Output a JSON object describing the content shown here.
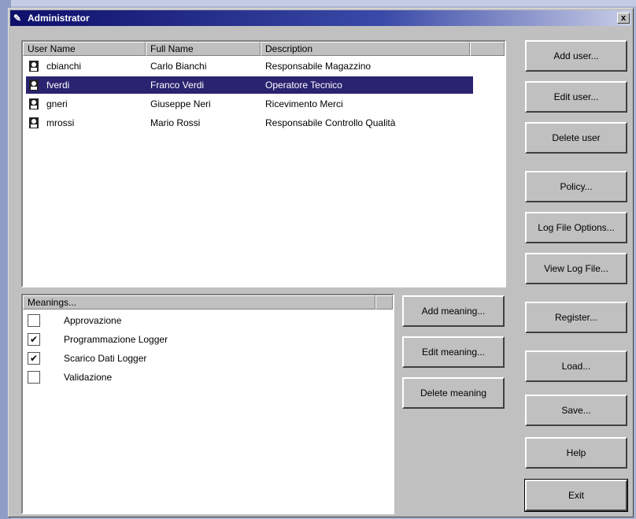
{
  "window": {
    "title": "Administrator",
    "close_label": "x"
  },
  "users_table": {
    "columns": [
      "User Name",
      "Full Name",
      "Description"
    ],
    "rows": [
      {
        "user": "cbianchi",
        "full": "Carlo Bianchi",
        "desc": "Responsabile Magazzino",
        "selected": false
      },
      {
        "user": "fverdi",
        "full": "Franco Verdi",
        "desc": "Operatore Tecnico",
        "selected": true
      },
      {
        "user": "gneri",
        "full": "Giuseppe Neri",
        "desc": "Ricevimento Merci",
        "selected": false
      },
      {
        "user": "mrossi",
        "full": "Mario Rossi",
        "desc": "Responsabile Controllo Qualità",
        "selected": false
      }
    ]
  },
  "meanings": {
    "header": "Meanings...",
    "items": [
      {
        "label": "Approvazione",
        "checked": false,
        "mark": ""
      },
      {
        "label": "Programmazione Logger",
        "checked": true,
        "mark": "✔"
      },
      {
        "label": "Scarico Dati Logger",
        "checked": true,
        "mark": "✔"
      },
      {
        "label": "Validazione",
        "checked": false,
        "mark": ""
      }
    ]
  },
  "meaning_buttons": {
    "add": "Add meaning...",
    "edit": "Edit meaning...",
    "delete": "Delete meaning"
  },
  "side_buttons": {
    "add_user": "Add user...",
    "edit_user": "Edit user...",
    "delete_user": "Delete user",
    "policy": "Policy...",
    "log_file_options": "Log File Options...",
    "view_log_file": "View Log File...",
    "register": "Register...",
    "load": "Load...",
    "save": "Save...",
    "help": "Help",
    "exit": "Exit"
  }
}
